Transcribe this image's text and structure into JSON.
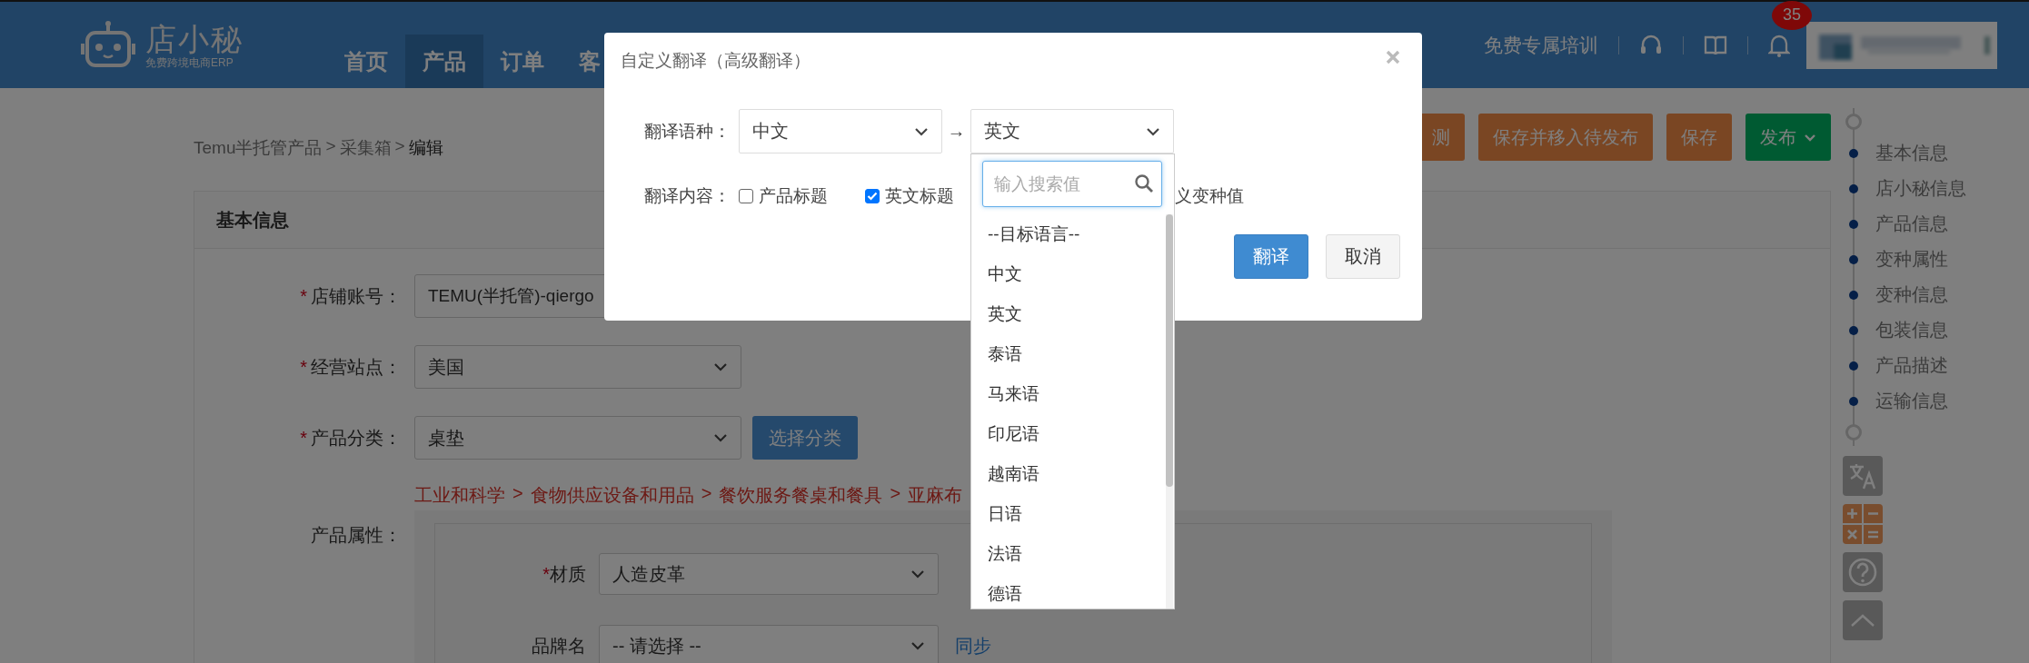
{
  "header": {
    "logo_title": "店小秘",
    "logo_subtitle": "免费跨境电商ERP",
    "nav": [
      {
        "label": "首页",
        "selected": false
      },
      {
        "label": "产品",
        "selected": true
      },
      {
        "label": "订单",
        "selected": false
      },
      {
        "label": "客",
        "selected": false
      }
    ],
    "training_link": "免费专属培训",
    "notification_count": "35"
  },
  "breadcrumb": {
    "separator": ">",
    "items": [
      "Temu半托管产品",
      "采集箱",
      "编辑"
    ]
  },
  "actions": [
    {
      "label": "测",
      "kind": "orange"
    },
    {
      "label": "保存并移入待发布",
      "kind": "orange"
    },
    {
      "label": "保存",
      "kind": "orange"
    },
    {
      "label": "发布",
      "kind": "green_dropdown"
    }
  ],
  "card": {
    "title": "基本信息",
    "required_mark": "*",
    "fields": [
      {
        "label": "店铺账号：",
        "required": true,
        "kind": "text",
        "value": "TEMU(半托管)-qiergo"
      },
      {
        "label": "经营站点：",
        "required": true,
        "kind": "select",
        "value": "美国"
      },
      {
        "label": "产品分类：",
        "required": true,
        "kind": "select",
        "value": "桌垫",
        "button": "选择分类"
      }
    ],
    "category_path": {
      "separator": ">",
      "items": [
        "工业和科学",
        "食物供应设备和用品",
        "餐饮服务餐桌和餐具",
        "亚麻布"
      ]
    },
    "attributes": {
      "label": "产品属性：",
      "items": [
        {
          "label": "材质",
          "required": true,
          "value": "人造皮革"
        },
        {
          "label": "品牌名",
          "required": false,
          "value": "-- 请选择 --",
          "link": "同步"
        }
      ]
    }
  },
  "side_nav": {
    "items": [
      "基本信息",
      "店小秘信息",
      "产品信息",
      "变种属性",
      "变种信息",
      "包装信息",
      "产品描述",
      "运输信息"
    ]
  },
  "modal": {
    "title": "自定义翻译（高级翻译）",
    "language_label": "翻译语种：",
    "source_language": "中文",
    "arrow": "→",
    "target_language": "英文",
    "content_label": "翻译内容：",
    "options": [
      {
        "label": "产品标题",
        "checked": false
      },
      {
        "label": "英文标题",
        "checked": true
      }
    ],
    "clipped_option_label": "义变种值",
    "buttons": [
      {
        "label": "翻译",
        "kind": "primary"
      },
      {
        "label": "取消",
        "kind": "default"
      }
    ]
  },
  "dropdown": {
    "placeholder": "输入搜索值",
    "options": [
      "--目标语言--",
      "中文",
      "英文",
      "泰语",
      "马来语",
      "印尼语",
      "越南语",
      "日语",
      "法语",
      "德语"
    ]
  }
}
